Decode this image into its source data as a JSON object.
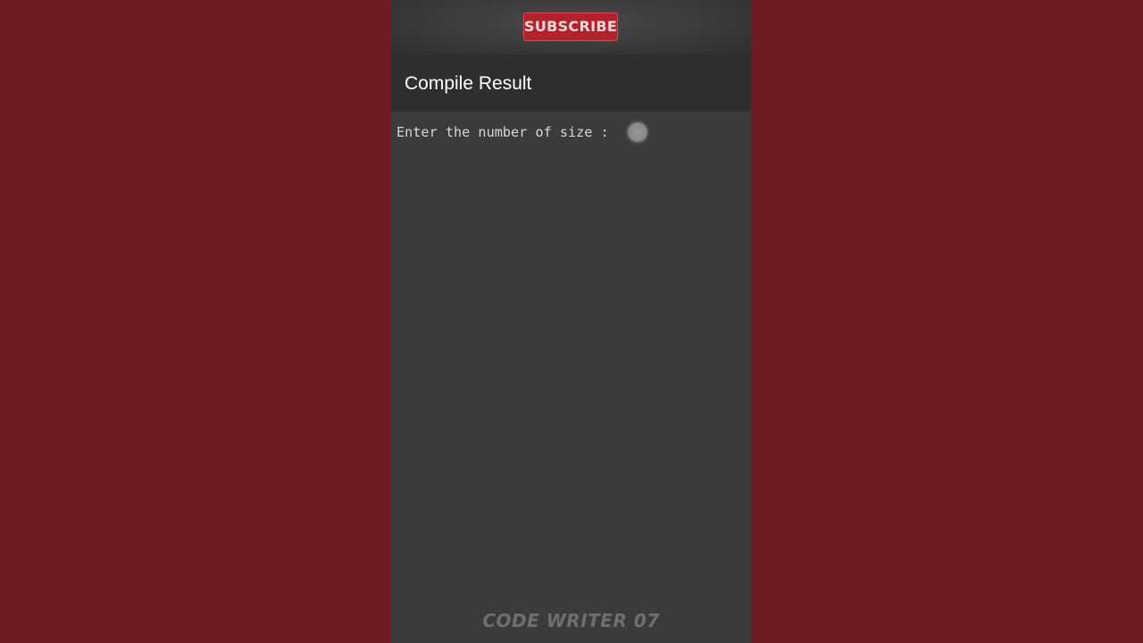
{
  "banner": {
    "subscribe_label": "SUBSCRIBE"
  },
  "header": {
    "title": "Compile Result"
  },
  "console": {
    "prompt_text": "Enter the number of size : "
  },
  "watermark": {
    "text": "CODE WRITER 07"
  },
  "colors": {
    "backdrop": "#6e1c24",
    "subscribe_bg": "#b3212b",
    "header_bg": "#2e2e2e",
    "console_bg": "#3b3b3b"
  }
}
